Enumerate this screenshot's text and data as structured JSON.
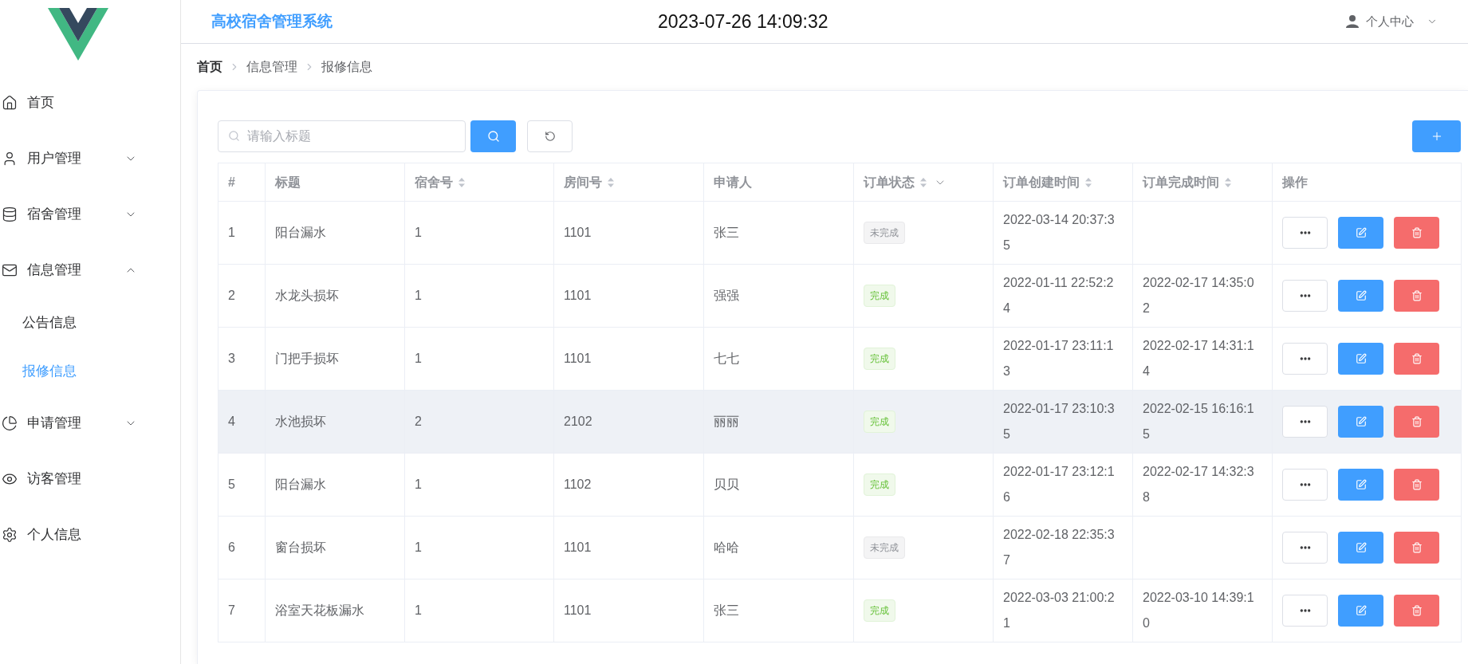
{
  "app_title": "高校宿舍管理系统",
  "clock": "2023-07-26 14:09:32",
  "user_menu": {
    "label": "个人中心"
  },
  "sidebar": {
    "items": [
      {
        "label": "首页",
        "selected": false
      },
      {
        "label": "用户管理",
        "expanded": false,
        "selected": false
      },
      {
        "label": "宿舍管理",
        "expanded": false,
        "selected": false
      },
      {
        "label": "信息管理",
        "expanded": true,
        "selected": false,
        "children": [
          {
            "label": "公告信息",
            "selected": false
          },
          {
            "label": "报修信息",
            "selected": true
          }
        ]
      },
      {
        "label": "申请管理",
        "expanded": false,
        "selected": false
      },
      {
        "label": "访客管理",
        "selected": false
      },
      {
        "label": "个人信息",
        "selected": false
      }
    ]
  },
  "breadcrumb": [
    "首页",
    "信息管理",
    "报修信息"
  ],
  "search": {
    "placeholder": "请输入标题"
  },
  "table": {
    "columns": [
      {
        "label": "#",
        "sortable": false,
        "filterable": false
      },
      {
        "label": "标题",
        "sortable": false,
        "filterable": false
      },
      {
        "label": "宿舍号",
        "sortable": true,
        "filterable": false
      },
      {
        "label": "房间号",
        "sortable": true,
        "filterable": false
      },
      {
        "label": "申请人",
        "sortable": false,
        "filterable": false
      },
      {
        "label": "订单状态",
        "sortable": true,
        "filterable": true
      },
      {
        "label": "订单创建时间",
        "sortable": true,
        "filterable": false
      },
      {
        "label": "订单完成时间",
        "sortable": true,
        "filterable": false
      },
      {
        "label": "操作",
        "sortable": false,
        "filterable": false
      }
    ],
    "rows": [
      {
        "index": "1",
        "title": "阳台漏水",
        "building": "1",
        "room": "1101",
        "applicant": "张三",
        "status": {
          "label": "未完成",
          "done": false
        },
        "created": "2022-03-14 20:37:35",
        "highlighted": false
      },
      {
        "index": "2",
        "title": "水龙头损坏",
        "building": "1",
        "room": "1101",
        "applicant": "强强",
        "status": {
          "label": "完成",
          "done": true
        },
        "created": "2022-01-11 22:52:24",
        "completed": "2022-02-17 14:35:02",
        "highlighted": false
      },
      {
        "index": "3",
        "title": "门把手损坏",
        "building": "1",
        "room": "1101",
        "applicant": "七七",
        "status": {
          "label": "完成",
          "done": true
        },
        "created": "2022-01-17 23:11:13",
        "completed": "2022-02-17 14:31:14",
        "highlighted": false
      },
      {
        "index": "4",
        "title": "水池损坏",
        "building": "2",
        "room": "2102",
        "applicant": "丽丽",
        "status": {
          "label": "完成",
          "done": true
        },
        "created": "2022-01-17 23:10:35",
        "completed": "2022-02-15 16:16:15",
        "highlighted": true
      },
      {
        "index": "5",
        "title": "阳台漏水",
        "building": "1",
        "room": "1102",
        "applicant": "贝贝",
        "status": {
          "label": "完成",
          "done": true
        },
        "created": "2022-01-17 23:12:16",
        "completed": "2022-02-17 14:32:38",
        "highlighted": false
      },
      {
        "index": "6",
        "title": "窗台损坏",
        "building": "1",
        "room": "1101",
        "applicant": "哈哈",
        "status": {
          "label": "未完成",
          "done": false
        },
        "created": "2022-02-18 22:35:37",
        "highlighted": false
      },
      {
        "index": "7",
        "title": "浴室天花板漏水",
        "building": "1",
        "room": "1101",
        "applicant": "张三",
        "status": {
          "label": "完成",
          "done": true
        },
        "created": "2022-03-03 21:00:21",
        "completed": "2022-03-10 14:39:10",
        "highlighted": false
      }
    ]
  }
}
